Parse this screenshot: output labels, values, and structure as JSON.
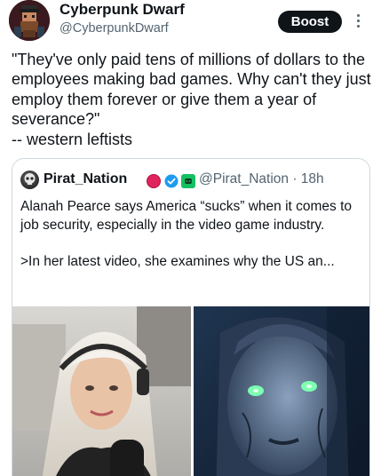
{
  "author": {
    "name": "Cyberpunk Dwarf",
    "handle": "@CyberpunkDwarf",
    "avatar_icon": "pixel-dwarf-avatar-icon"
  },
  "actions": {
    "boost_label": "Boost",
    "more_icon": "more-vertical-icon"
  },
  "post": {
    "text": "\"They've only paid tens of millions of dollars to the employees making bad games.  Why can't they just employ them forever or give them a year of severance?\"\n-- western leftists"
  },
  "quoted": {
    "name": "Pirat_Nation",
    "handle_time": "@Pirat_Nation · 18h",
    "text": "Alanah Pearce says America “sucks” when it comes to job security, especially in the video game industry.\n\n>In her latest video, she examines why the US an...",
    "badges": [
      "red-circle-icon",
      "verified-check-icon",
      "green-badge-icon"
    ],
    "colors": {
      "verified": "#1d9bf0",
      "red": "#e0245e",
      "green": "#17bf63"
    }
  },
  "media": [
    {
      "name": "streamer-photo"
    },
    {
      "name": "android-character-render"
    }
  ]
}
